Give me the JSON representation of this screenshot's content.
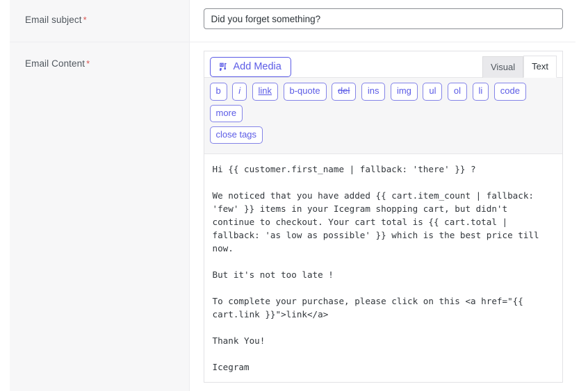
{
  "form": {
    "rows": [
      {
        "label": "Email subject",
        "required_marker": "*"
      },
      {
        "label": "Email Content",
        "required_marker": "*"
      }
    ]
  },
  "subject": {
    "value": "Did you forget something?",
    "placeholder": "Enter email subject"
  },
  "editor": {
    "add_media_label": "Add Media",
    "add_media_icon": "admin-media-icon",
    "tabs": [
      {
        "label": "Visual",
        "active": false
      },
      {
        "label": "Text",
        "active": true
      }
    ],
    "quicktags": [
      {
        "label": "b",
        "style": "bold"
      },
      {
        "label": "i",
        "style": "italic"
      },
      {
        "label": "link",
        "style": "underline"
      },
      {
        "label": "b-quote",
        "style": "plain"
      },
      {
        "label": "del",
        "style": "strike"
      },
      {
        "label": "ins",
        "style": "plain"
      },
      {
        "label": "img",
        "style": "plain"
      },
      {
        "label": "ul",
        "style": "plain"
      },
      {
        "label": "ol",
        "style": "plain"
      },
      {
        "label": "li",
        "style": "plain"
      },
      {
        "label": "code",
        "style": "plain"
      },
      {
        "label": "more",
        "style": "plain"
      },
      {
        "label": "close tags",
        "style": "plain"
      }
    ],
    "content": "Hi {{ customer.first_name | fallback: 'there' }} ?\n\nWe noticed that you have added {{ cart.item_count | fallback: 'few' }} items in your Icegram shopping cart, but didn't continue to checkout. Your cart total is {{ cart.total | fallback: 'as low as possible' }} which is the best price till now.\n\nBut it's not too late !\n\nTo complete your purchase, please click on this <a href=\"{{ cart.link }}\">link</a>\n\nThank You!\n\nIcegram"
  },
  "colors": {
    "accent": "#5b5be6",
    "required": "#d9534f",
    "label_cell_bg": "#f7f7f8",
    "toolbar_bg": "#f6f6f7",
    "border": "#ededf0"
  }
}
